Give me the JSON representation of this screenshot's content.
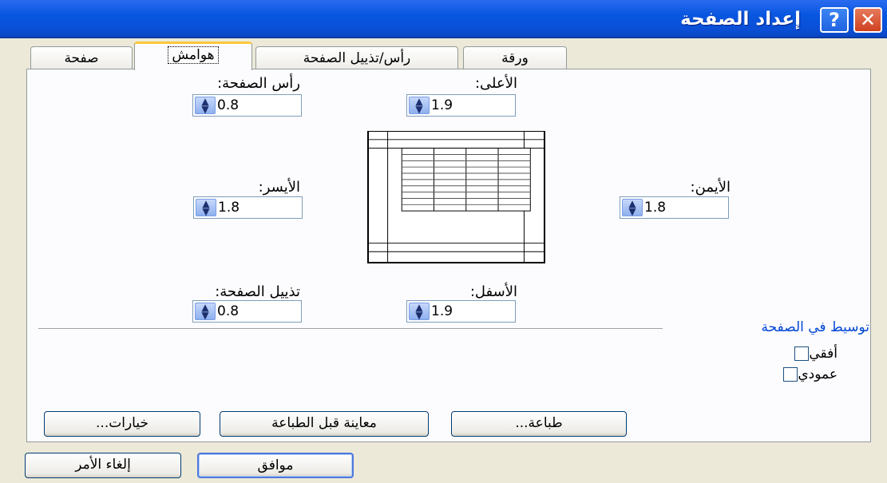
{
  "window": {
    "title": "إعداد الصفحة",
    "help_glyph": "?",
    "close_glyph": "✕"
  },
  "tabs": [
    {
      "label": "ورقة"
    },
    {
      "label": "رأس/تذييل الصفحة"
    },
    {
      "label": "هوامش"
    },
    {
      "label": "صفحة"
    }
  ],
  "margins": {
    "top": {
      "label": "الأعلى:",
      "value": "1.9"
    },
    "header": {
      "label": "رأس الصفحة:",
      "value": "0.8"
    },
    "right": {
      "label": "الأيمن:",
      "value": "1.8"
    },
    "left": {
      "label": "الأيسر:",
      "value": "1.8"
    },
    "bottom": {
      "label": "الأسفل:",
      "value": "1.9"
    },
    "footer": {
      "label": "تذييل الصفحة:",
      "value": "0.8"
    }
  },
  "center_on_page": {
    "title": "توسيط في الصفحة",
    "horizontal": {
      "label": "أفقي",
      "checked": false
    },
    "vertical": {
      "label": "عمودي",
      "checked": false
    }
  },
  "buttons": {
    "print": "طباعة...",
    "print_preview": "معاينة قبل الطباعة",
    "options": "خيارات...",
    "ok": "موافق",
    "cancel": "إلغاء الأمر"
  },
  "icons": {
    "spinner": "up-down-arrows-icon",
    "help": "help-icon",
    "close": "close-icon"
  },
  "colors": {
    "titlebar": "#0856e0",
    "accent_blue": "#0046d5",
    "dialog_bg": "#ece9d8"
  }
}
